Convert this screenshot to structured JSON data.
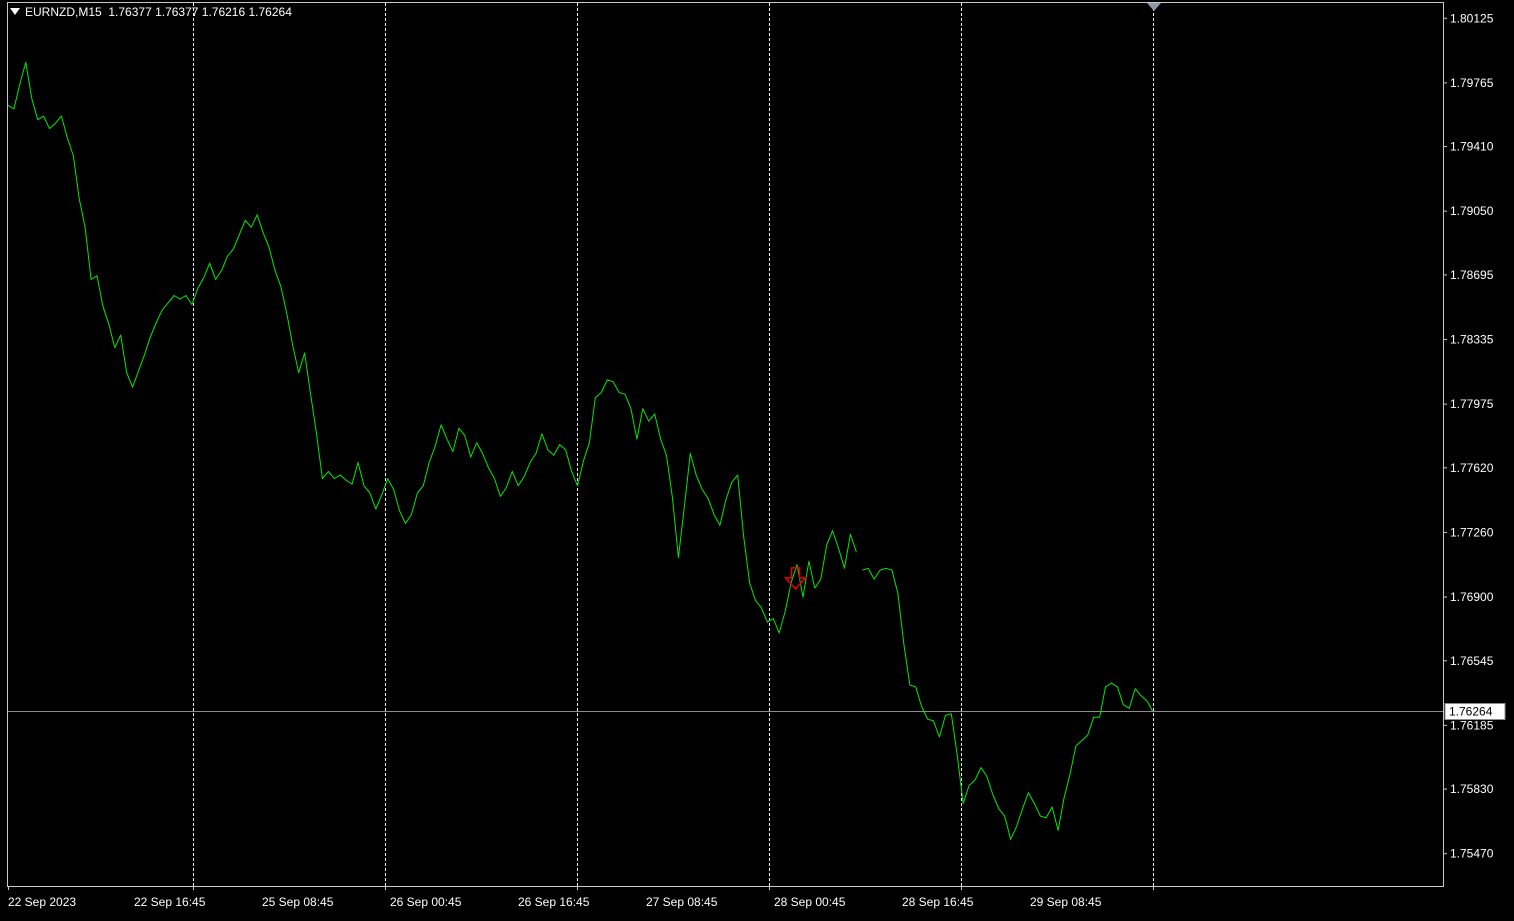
{
  "window": {
    "symbol": "EURNZD,M15",
    "ohlc": "1.76377 1.76377 1.76216 1.76264"
  },
  "colors": {
    "background": "#000000",
    "price_line": "#00e800",
    "grid": "#ffffff",
    "axis_text": "#ffffff",
    "current_price_line": "#8c8c8c",
    "arrow": "#e00000",
    "shift_marker": "#8c9aa8"
  },
  "icons": {
    "dropdown": "triangle-down-icon",
    "sell_signal": "down-arrow-icon",
    "shift_marker": "triangle-down-icon"
  },
  "chart_data": {
    "type": "line",
    "title": "EURNZD,M15",
    "xlabel": "",
    "ylabel": "",
    "ylim": [
      1.7529,
      1.8021
    ],
    "grid": "vertical dotted",
    "y_ticks": [
      "1.80125",
      "1.79765",
      "1.79410",
      "1.79050",
      "1.78695",
      "1.78335",
      "1.77975",
      "1.77620",
      "1.77260",
      "1.76900",
      "1.76545",
      "1.76185",
      "1.75830",
      "1.75470"
    ],
    "x_ticks": [
      "22 Sep 2023",
      "22 Sep 16:45",
      "25 Sep 08:45",
      "26 Sep 00:45",
      "26 Sep 16:45",
      "27 Sep 08:45",
      "28 Sep 00:45",
      "28 Sep 16:45",
      "29 Sep 08:45"
    ],
    "current_price": 1.76264,
    "current_price_label": "1.76264",
    "signal_arrow": {
      "direction": "down",
      "x": 265.5,
      "price": 1.7699
    },
    "series": [
      {
        "x": [
          0,
          2,
          4,
          6,
          8,
          10,
          12,
          14,
          16,
          18,
          20,
          22,
          24,
          26,
          28,
          30,
          32,
          34,
          36,
          38,
          40,
          42,
          44,
          46,
          48,
          50,
          52,
          54,
          56,
          58,
          60,
          62,
          64,
          66,
          68,
          70,
          72,
          74,
          76,
          78,
          80,
          82,
          84,
          86,
          88,
          90,
          92,
          94,
          96,
          98,
          100,
          102,
          104,
          106,
          108,
          110,
          112,
          114,
          116,
          118,
          120,
          122,
          124,
          126,
          128,
          130,
          132,
          134,
          136,
          138,
          140,
          142,
          144,
          146,
          148,
          150,
          152,
          154,
          156,
          158,
          160,
          162,
          164,
          166,
          168,
          170,
          172,
          174,
          176,
          178,
          180,
          182,
          184,
          186,
          188,
          190,
          192,
          194,
          196,
          198,
          200,
          202,
          204,
          206,
          208,
          210,
          212,
          214,
          216,
          218,
          220,
          222,
          224,
          226,
          228,
          230,
          232,
          234,
          236,
          238,
          240,
          242,
          244,
          246,
          248,
          250,
          252,
          254,
          256,
          258,
          260,
          262,
          264,
          266,
          268,
          270,
          272,
          274,
          276,
          278,
          280,
          282,
          284,
          286
        ],
        "values": [
          1.7964,
          1.7962,
          1.7976,
          1.7988,
          1.7968,
          1.7956,
          1.7958,
          1.7951,
          1.7954,
          1.7958,
          1.7946,
          1.7936,
          1.7912,
          1.7896,
          1.7867,
          1.7869,
          1.7852,
          1.7842,
          1.7829,
          1.7836,
          1.7815,
          1.7807,
          1.7816,
          1.7825,
          1.7835,
          1.7843,
          1.785,
          1.7854,
          1.7858,
          1.7856,
          1.7858,
          1.7853,
          1.7862,
          1.7868,
          1.7876,
          1.7867,
          1.7872,
          1.788,
          1.7884,
          1.7892,
          1.79,
          1.7896,
          1.7903,
          1.7893,
          1.7885,
          1.7872,
          1.7863,
          1.7848,
          1.783,
          1.7815,
          1.7826,
          1.7803,
          1.7781,
          1.7756,
          1.776,
          1.7756,
          1.7758,
          1.7755,
          1.7753,
          1.7765,
          1.7752,
          1.7748,
          1.7739,
          1.7747,
          1.7756,
          1.775,
          1.7738,
          1.7731,
          1.7736,
          1.7748,
          1.7752,
          1.7765,
          1.7774,
          1.7786,
          1.7778,
          1.7771,
          1.7784,
          1.778,
          1.7768,
          1.7776,
          1.777,
          1.7762,
          1.7756,
          1.7746,
          1.7751,
          1.776,
          1.7752,
          1.7757,
          1.7765,
          1.777,
          1.7781,
          1.7772,
          1.7769,
          1.7775,
          1.7772,
          1.776,
          1.7752,
          1.7766,
          1.7776,
          1.7801,
          1.7804,
          1.7811,
          1.781,
          1.7804,
          1.7803,
          1.7795,
          1.7778,
          1.7795,
          1.7788,
          1.7792,
          1.7778,
          1.7769,
          1.7745,
          1.7712,
          1.774,
          1.777,
          1.7758,
          1.775,
          1.7745,
          1.7736,
          1.773,
          1.7744,
          1.7754,
          1.7758,
          1.7724,
          1.7698,
          1.7688,
          1.7684,
          1.7676,
          1.7678,
          1.767,
          1.7682,
          1.7698,
          1.7708,
          1.769,
          1.771,
          1.7695,
          1.77,
          1.7719,
          1.7727,
          1.7717,
          1.7706,
          1.7725,
          1.7715
        ]
      },
      {
        "x": [
          288,
          290,
          292,
          294,
          296,
          298,
          300,
          302,
          304,
          306,
          308,
          310,
          312,
          314,
          316,
          318,
          320,
          322,
          324,
          326,
          328,
          330,
          332,
          334,
          336,
          338,
          340,
          342,
          344,
          346,
          348,
          350,
          352,
          354,
          356,
          358,
          360,
          362,
          364,
          366,
          368,
          370,
          372,
          374,
          376,
          378,
          380,
          382,
          384,
          386
        ],
        "values": [
          1.7705,
          1.7706,
          1.77,
          1.7705,
          1.7706,
          1.7705,
          1.7692,
          1.7664,
          1.7641,
          1.764,
          1.7629,
          1.7622,
          1.7621,
          1.7612,
          1.7624,
          1.7625,
          1.7602,
          1.7575,
          1.7585,
          1.7588,
          1.7595,
          1.759,
          1.758,
          1.7572,
          1.7568,
          1.7555,
          1.7562,
          1.7572,
          1.7581,
          1.7575,
          1.7568,
          1.7567,
          1.7573,
          1.756,
          1.7578,
          1.7591,
          1.7607,
          1.761,
          1.7613,
          1.7623,
          1.7623,
          1.764,
          1.7642,
          1.764,
          1.763,
          1.7628,
          1.7639,
          1.7635,
          1.7632,
          1.7626
        ]
      }
    ]
  }
}
